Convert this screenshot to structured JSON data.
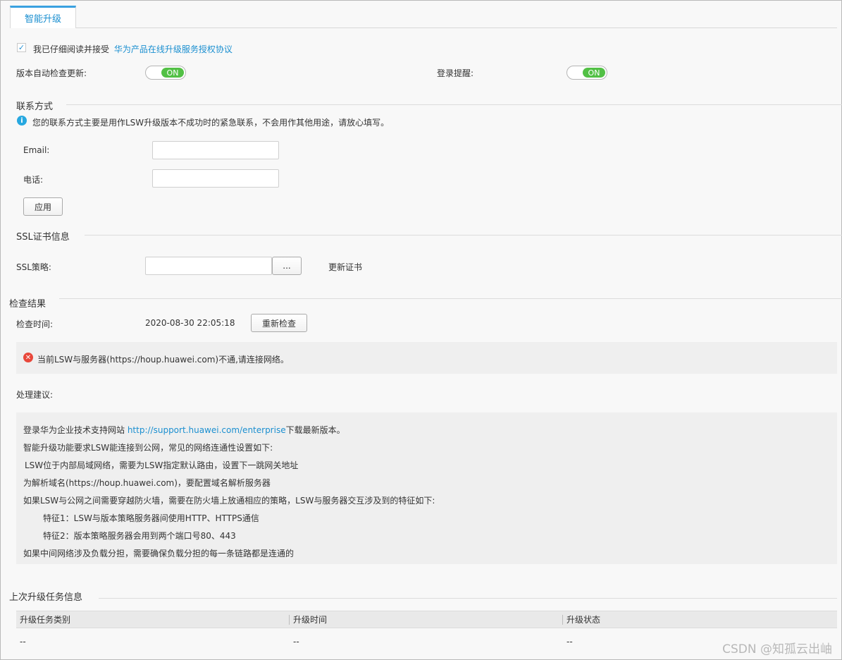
{
  "tab": {
    "label": "智能升级"
  },
  "agreement": {
    "checked": true,
    "prefix": "我已仔细阅读并接受",
    "link": "华为产品在线升级服务授权协议"
  },
  "auto_check": {
    "label": "版本自动检查更新:",
    "state": "ON"
  },
  "login_reminder": {
    "label": "登录提醒:",
    "state": "ON"
  },
  "contact": {
    "title": "联系方式",
    "notice": "您的联系方式主要是用作LSW升级版本不成功时的紧急联系，不会用作其他用途，请放心填写。",
    "email_label": "Email:",
    "email_value": "",
    "phone_label": "电话:",
    "phone_value": "",
    "apply_button": "应用"
  },
  "ssl": {
    "title": "SSL证书信息",
    "policy_label": "SSL策略:",
    "policy_value": "",
    "browse_button": "...",
    "update_link": "更新证书"
  },
  "check": {
    "title": "检查结果",
    "time_label": "检查时间:",
    "time_value": "2020-08-30 22:05:18",
    "recheck_button": "重新检查",
    "error_message": "当前LSW与服务器(https://houp.huawei.com)不通,请连接网络。",
    "advice_label": "处理建议:",
    "advice": {
      "line1_prefix": "登录华为企业技术支持网站 ",
      "line1_link": "http://support.huawei.com/enterprise",
      "line1_suffix": "下载最新版本。",
      "line2": "智能升级功能要求LSW能连接到公网，常见的网络连通性设置如下:",
      "line3": "LSW位于内部局域网络，需要为LSW指定默认路由，设置下一跳网关地址",
      "line4": "为解析域名(https://houp.huawei.com)，要配置域名解析服务器",
      "line5": "如果LSW与公网之间需要穿越防火墙，需要在防火墙上放通相应的策略，LSW与服务器交互涉及到的特征如下:",
      "line6": "特征1：LSW与版本策略服务器间使用HTTP、HTTPS通信",
      "line7": "特征2：版本策略服务器会用到两个端口号80、443",
      "line8": "如果中间网络涉及负载分担，需要确保负载分担的每一条链路都是连通的"
    }
  },
  "last_task": {
    "title": "上次升级任务信息",
    "columns": [
      "升级任务类别",
      "升级时间",
      "升级状态"
    ],
    "rows": [
      [
        "--",
        "--",
        "--"
      ]
    ]
  },
  "watermark": "CSDN @知孤云出岫",
  "colors": {
    "accent": "#1b8fd0",
    "toggle_on": "#52c045",
    "error": "#e8473a",
    "info": "#27a8e0"
  },
  "icons": {
    "info": "info-icon",
    "error": "error-icon",
    "check": "checkmark-icon"
  }
}
